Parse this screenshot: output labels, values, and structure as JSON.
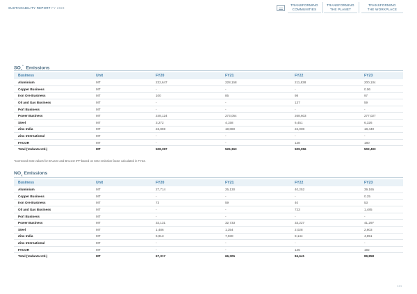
{
  "header": {
    "report_title": "SUSTAINABILITY REPORT",
    "report_year": "FY 2023",
    "tabs": [
      {
        "line1": "TRANSFORMING",
        "line2": "COMMUNITIES"
      },
      {
        "line1": "TRANSFORMING",
        "line2": "THE PLANET"
      },
      {
        "line1": "TRANSFORMING",
        "line2": "THE WORKPLACE"
      }
    ]
  },
  "so2": {
    "title_prefix": "SO",
    "title_sub": "x",
    "title_sup": "*",
    "title_suffix": "  Emissions",
    "columns": [
      "Business",
      "Unit",
      "FY20",
      "FY21",
      "FY22",
      "FY23"
    ],
    "rows": [
      [
        "Aluminium",
        "MT",
        "232,647",
        "228,158",
        "211,838",
        "200,104"
      ],
      [
        "Copper Business",
        "MT",
        "-",
        "-",
        "-",
        "0.06"
      ],
      [
        "Iron Ore Business",
        "MT",
        "100",
        "85",
        "98",
        "97"
      ],
      [
        "Oil and Gas Business",
        "MT",
        "-",
        "-",
        "137",
        "59"
      ],
      [
        "Port Business",
        "MT",
        "-",
        "-",
        "-",
        "-"
      ],
      [
        "Power Business",
        "MT",
        "248,124",
        "273,054",
        "268,603",
        "277,027"
      ],
      [
        "Steel",
        "MT",
        "3,272",
        "4,158",
        "6,451",
        "6,326"
      ],
      [
        "Zinc India",
        "MT",
        "23,859",
        "19,880",
        "22,008",
        "18,449"
      ],
      [
        "Zinc International",
        "MT",
        "-",
        "-",
        "-",
        "-"
      ],
      [
        "FACOR",
        "MT",
        "-",
        "-",
        "128",
        "180"
      ]
    ],
    "total": [
      "Total (Vedanta Ltd.)",
      "MT",
      "508,397",
      "526,363",
      "509,056",
      "502,403"
    ]
  },
  "footnote": "*Corrected SO2 values for BALCO and BALCO IPP based on SO2 emission factor calculated in FY23.",
  "nox": {
    "title_prefix": "NO",
    "title_sub": "x",
    "title_suffix": " Emissions",
    "columns": [
      "Business",
      "Unit",
      "FY20",
      "FY21",
      "FY22",
      "FY23"
    ],
    "rows": [
      [
        "Aluminium",
        "MT",
        "27,714",
        "25,130",
        "40,252",
        "39,165"
      ],
      [
        "Copper Business",
        "MT",
        "-",
        "-",
        "-",
        "0.25"
      ],
      [
        "Iron Ore Business",
        "MT",
        "73",
        "59",
        "40",
        "53"
      ],
      [
        "Oil and Gas Business",
        "MT",
        "-",
        "-",
        "723",
        "1,485"
      ],
      [
        "Port Business",
        "MT",
        "-",
        "-",
        "-",
        "-"
      ],
      [
        "Power Business",
        "MT",
        "32,131",
        "32,733",
        "33,227",
        "41,297"
      ],
      [
        "Steel",
        "MT",
        "1,486",
        "1,354",
        "2,028",
        "2,803"
      ],
      [
        "Zinc India",
        "MT",
        "6,913",
        "7,030",
        "8,144",
        "4,851"
      ],
      [
        "Zinc International",
        "MT",
        "-",
        "-",
        "-",
        "-"
      ],
      [
        "FACOR",
        "MT",
        "-",
        "-",
        "145",
        "192"
      ]
    ],
    "total": [
      "Total (Vedanta Ltd.)",
      "MT",
      "67,317",
      "66,305",
      "84,641",
      "89,858"
    ]
  },
  "page_number": "121"
}
